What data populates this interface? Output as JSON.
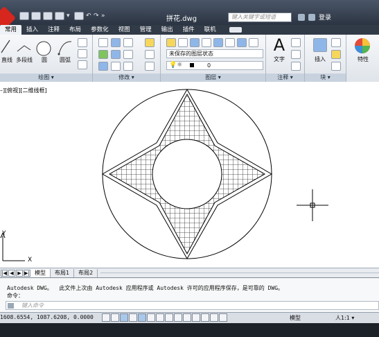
{
  "window": {
    "title": "拼花.dwg",
    "search_placeholder": "键入关键字或短语",
    "login_label": "登录"
  },
  "ribbon": {
    "tabs": [
      "常用",
      "插入",
      "注释",
      "布局",
      "参数化",
      "视图",
      "管理",
      "输出",
      "插件",
      "联机"
    ],
    "panels": [
      "绘图 ▾",
      "修改 ▾",
      "图层 ▾",
      "注释 ▾",
      "块 ▾"
    ],
    "draw": {
      "line": "直线",
      "polyline": "多段线",
      "circle": "圆",
      "arc": "圆弧"
    },
    "layers": {
      "state": "未保存的图层状态",
      "current": "0"
    },
    "annotation": {
      "text": "文字"
    },
    "block": {
      "insert": "插入"
    },
    "properties": {
      "label": "特性"
    }
  },
  "canvas": {
    "viewport_label": "–][俯视][二维线框]",
    "ucs_y": "Y",
    "ucs_x": "X"
  },
  "layout": {
    "tabs": [
      "模型",
      "布局1",
      "布局2"
    ]
  },
  "command": {
    "history": [
      "Autodesk DWG。  此文件上次由 Autodesk 应用程序或 Autodesk 许可的应用程序保存，是可靠的 DWG。",
      "命令："
    ],
    "placeholder": "键入命令"
  },
  "status": {
    "coordinates": "1608.6554, 1087.6208, 0.0000",
    "model": "模型",
    "scale": "人1:1 ▾"
  }
}
